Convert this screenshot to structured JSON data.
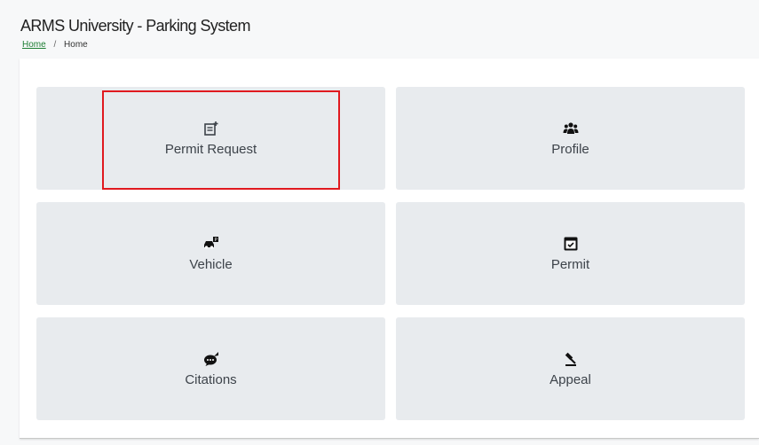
{
  "header": {
    "title": "ARMS University - Parking System"
  },
  "breadcrumb": {
    "home_link": "Home",
    "separator": "/",
    "current": "Home"
  },
  "tiles": [
    {
      "label": "Permit Request",
      "icon": "permit-request-icon"
    },
    {
      "label": "Profile",
      "icon": "users-icon"
    },
    {
      "label": "Vehicle",
      "icon": "car-parking-icon"
    },
    {
      "label": "Permit",
      "icon": "calendar-check-icon"
    },
    {
      "label": "Citations",
      "icon": "citation-icon"
    },
    {
      "label": "Appeal",
      "icon": "gavel-icon"
    }
  ],
  "colors": {
    "highlight": "#e0191f",
    "tile_bg": "#e8ebee",
    "link": "#1e7e34"
  }
}
